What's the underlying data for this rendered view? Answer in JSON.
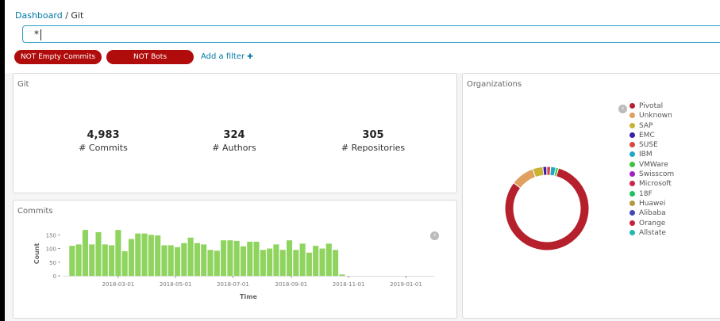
{
  "breadcrumb": {
    "dashboard": "Dashboard",
    "separator": "/",
    "current": "Git"
  },
  "query": {
    "value": "*"
  },
  "filters": [
    {
      "label": "NOT Empty Commits"
    },
    {
      "label": "NOT Bots"
    }
  ],
  "add_filter": {
    "label": "Add a filter",
    "plus": "✚"
  },
  "git_panel": {
    "title": "Git",
    "metrics": [
      {
        "value": "4,983",
        "label": "# Commits"
      },
      {
        "value": "324",
        "label": "# Authors"
      },
      {
        "value": "305",
        "label": "# Repositories"
      }
    ]
  },
  "commits_panel": {
    "title": "Commits",
    "toggle_icon": "‹"
  },
  "organizations_panel": {
    "title": "Organizations",
    "legend_toggle_icon": "‹",
    "legend": [
      {
        "label": "Pivotal",
        "color": "#b5202c"
      },
      {
        "label": "Unknown",
        "color": "#e0a060"
      },
      {
        "label": "SAP",
        "color": "#c8b432"
      },
      {
        "label": "EMC",
        "color": "#3a1fa8"
      },
      {
        "label": "SUSE",
        "color": "#d9473e"
      },
      {
        "label": "IBM",
        "color": "#20a8c8"
      },
      {
        "label": "VMWare",
        "color": "#3cc43c"
      },
      {
        "label": "Swisscom",
        "color": "#a020c8"
      },
      {
        "label": "Microsoft",
        "color": "#d02050"
      },
      {
        "label": "18F",
        "color": "#20c060"
      },
      {
        "label": "Huawei",
        "color": "#b8963c"
      },
      {
        "label": "Alibaba",
        "color": "#4048b8"
      },
      {
        "label": "Orange",
        "color": "#c8203c"
      },
      {
        "label": "Allstate",
        "color": "#20b8b0"
      }
    ]
  },
  "chart_data": [
    {
      "type": "bar",
      "title": "Commits",
      "xlabel": "Time",
      "ylabel": "Count",
      "ylim": [
        0,
        180
      ],
      "yticks": [
        0,
        50,
        100,
        150
      ],
      "xticks": [
        "2018-03-01",
        "2018-05-01",
        "2018-07-01",
        "2018-09-01",
        "2018-11-01",
        "2019-01-01"
      ],
      "x_start": "2018-01-08",
      "bar_interval": "week",
      "color": "#8fd45f",
      "values": [
        110,
        115,
        168,
        115,
        160,
        115,
        112,
        168,
        90,
        135,
        155,
        155,
        150,
        148,
        112,
        112,
        105,
        120,
        140,
        120,
        115,
        95,
        92,
        130,
        130,
        128,
        108,
        125,
        125,
        95,
        100,
        115,
        95,
        130,
        95,
        118,
        85,
        110,
        100,
        118,
        95,
        5
      ]
    },
    {
      "type": "pie",
      "donut": true,
      "categories": [
        "Pivotal",
        "Unknown",
        "SAP",
        "EMC",
        "SUSE",
        "IBM",
        "VMWare"
      ],
      "values": [
        81,
        9,
        4,
        1.5,
        1.5,
        2,
        1
      ]
    }
  ]
}
